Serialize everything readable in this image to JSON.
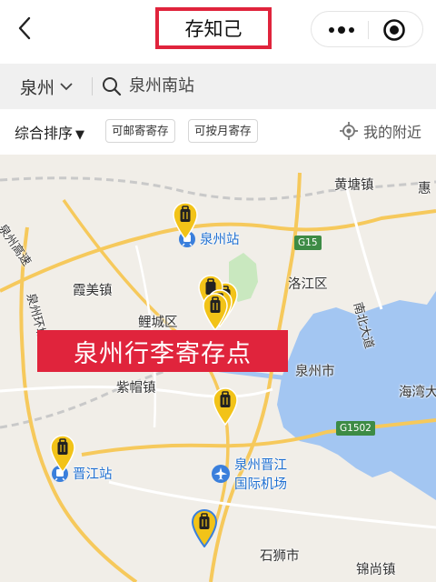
{
  "header": {
    "title": "存知己",
    "icons": {
      "back": "chevron-left-icon",
      "more": "more-dots-icon",
      "close": "target-close-icon"
    }
  },
  "search": {
    "city": "泉州",
    "query": "泉州南站"
  },
  "filters": {
    "sort_label": "综合排序",
    "sort_arrow": "▼",
    "chips": [
      "可邮寄寄存",
      "可按月寄存"
    ],
    "nearby_label": "我的附近"
  },
  "map": {
    "banner": "泉州行李寄存点",
    "places": {
      "huangtang": "黄塘镇",
      "hui": "惠",
      "quanzhou_station": "泉州站",
      "luojiang": "洛江区",
      "xiamei": "霞美镇",
      "licheng": "鲤城区",
      "nanbei": "南北大道",
      "quanzhou_city": "泉州市",
      "zimao": "紫帽镇",
      "haiwan": "海湾大",
      "jinjiang_station": "晋江站",
      "airport_line1": "泉州晋江",
      "airport_line2": "国际机场",
      "shishi": "石狮市",
      "jinshang": "锦尚镇",
      "highway1": "泉州高速",
      "highway2": "泉州环城高速"
    },
    "roads": {
      "g15": "G15",
      "g1502": "G1502"
    },
    "colors": {
      "water": "#a3c6f2",
      "park": "#c9e8bf",
      "road": "#f6c95c",
      "pin": "#f2c318",
      "banner": "#e0243c"
    }
  }
}
